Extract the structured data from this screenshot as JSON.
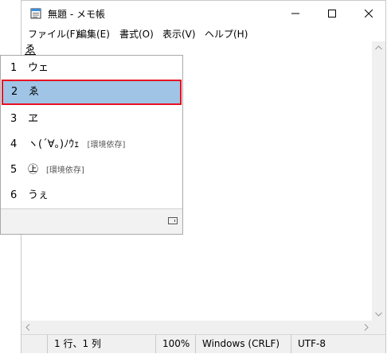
{
  "window": {
    "title": "無題 - メモ帳"
  },
  "menu": [
    "ファイル(F)",
    "編集(E)",
    "書式(O)",
    "表示(V)",
    "ヘルプ(H)"
  ],
  "editor": {
    "text": "ゑ"
  },
  "ime": {
    "candidates": [
      {
        "num": "1",
        "text": "ウェ",
        "note": ""
      },
      {
        "num": "2",
        "text": "ゑ",
        "note": ""
      },
      {
        "num": "3",
        "text": "ヱ",
        "note": ""
      },
      {
        "num": "4",
        "text": "ヽ(´∀。)ﾉｳｪ",
        "note": "[環境依存]"
      },
      {
        "num": "5",
        "text": "㊤",
        "note": "[環境依存]"
      },
      {
        "num": "6",
        "text": "うぇ",
        "note": ""
      }
    ],
    "selected_index": 1,
    "expand_icon": "expand-icon"
  },
  "status": {
    "position": "1 行、1 列",
    "zoom": "100%",
    "line_ending": "Windows (CRLF)",
    "encoding": "UTF-8"
  },
  "icons": {
    "app": "notepad-icon",
    "minimize": "minimize-icon",
    "maximize": "maximize-icon",
    "close": "close-icon",
    "scroll_up": "arrow-up-icon",
    "scroll_down": "arrow-down-icon",
    "scroll_left": "arrow-left-icon",
    "scroll_right": "arrow-right-icon"
  },
  "colors": {
    "selection": "#9fc4e6",
    "highlight_border": "#e81123",
    "chrome": "#f0f0f0"
  }
}
